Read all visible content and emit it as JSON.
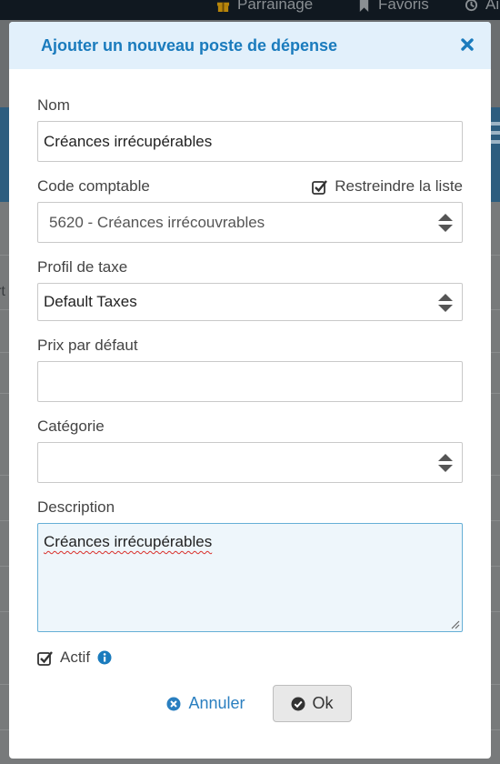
{
  "background": {
    "nav": [
      {
        "label": "Parrainage",
        "icon": "gift-icon"
      },
      {
        "label": "Favoris",
        "icon": "bookmark-icon"
      },
      {
        "label": "Ai",
        "icon": "history-icon"
      }
    ],
    "fragment": "rt"
  },
  "modal": {
    "title": "Ajouter un nouveau poste de dépense",
    "close_icon": "close-icon",
    "fields": {
      "nom": {
        "label": "Nom",
        "value": "Créances irrécupérables"
      },
      "code": {
        "label": "Code comptable",
        "restrict_label": "Restreindre la liste",
        "restrict_checked": true,
        "value": "5620 - Créances irrécouvrables"
      },
      "profil": {
        "label": "Profil de taxe",
        "value": "Default Taxes"
      },
      "prix": {
        "label": "Prix par défaut",
        "value": ""
      },
      "categorie": {
        "label": "Catégorie",
        "value": ""
      },
      "description": {
        "label": "Description",
        "value": "Créances irrécupérables"
      }
    },
    "actif": {
      "label": "Actif",
      "checked": true
    },
    "buttons": {
      "cancel": "Annuler",
      "ok": "Ok"
    }
  },
  "colors": {
    "accent": "#1a7bbd",
    "header_bg": "#e2f0fb",
    "link": "#2a7fc0"
  }
}
